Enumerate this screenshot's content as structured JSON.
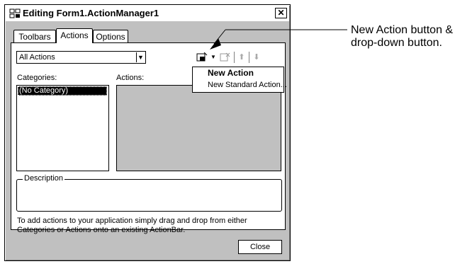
{
  "window": {
    "title": "Editing Form1.ActionManager1",
    "close_glyph": "✕"
  },
  "tabs": [
    {
      "label": "Toolbars",
      "active": false
    },
    {
      "label": "Actions",
      "active": true
    },
    {
      "label": "Options",
      "active": false
    }
  ],
  "filter": {
    "selected": "All Actions",
    "arrow_glyph": "▼"
  },
  "categories": {
    "label": "Categories:",
    "items": [
      "(No Category)"
    ]
  },
  "actions": {
    "label": "Actions:"
  },
  "toolbar": {
    "new_action_icon": "new-action-icon",
    "dropdown_glyph": "▼",
    "delete_icon": "delete-action-icon",
    "up_glyph": "⬆",
    "down_glyph": "⬇"
  },
  "menu": {
    "items": [
      "New Action",
      "New Standard Action..."
    ]
  },
  "description": {
    "label": "Description"
  },
  "help_text": "To add actions to your application simply drag and drop from either Categories or Actions onto an existing ActionBar.",
  "close_button": "Close",
  "callout": {
    "line1": "New Action button &",
    "line2": "drop-down button."
  }
}
